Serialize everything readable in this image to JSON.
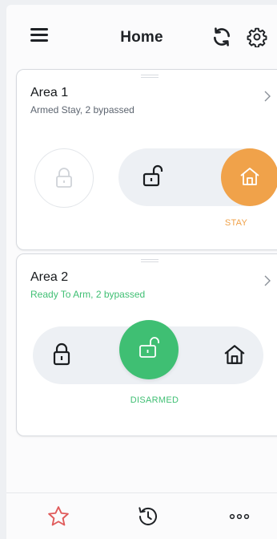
{
  "header": {
    "title": "Home"
  },
  "areas": [
    {
      "name": "Area 1",
      "status": "Armed Stay, 2 bypassed",
      "status_color": "#5d6570",
      "mode_label": "STAY",
      "mode_color": "#f0a24a"
    },
    {
      "name": "Area 2",
      "status": "Ready To Arm, 2 bypassed",
      "status_color": "#3fbf73",
      "mode_label": "DISARMED",
      "mode_color": "#3fbf73"
    }
  ],
  "icons": {
    "menu": "hamburger-icon",
    "refresh": "refresh-icon",
    "settings": "gear-icon",
    "favorites": "star-icon",
    "history": "history-icon",
    "more": "more-icon"
  },
  "colors": {
    "stay_accent": "#f0a24a",
    "disarmed_accent": "#3fbf73",
    "favorite_star": "#e05a5a"
  }
}
